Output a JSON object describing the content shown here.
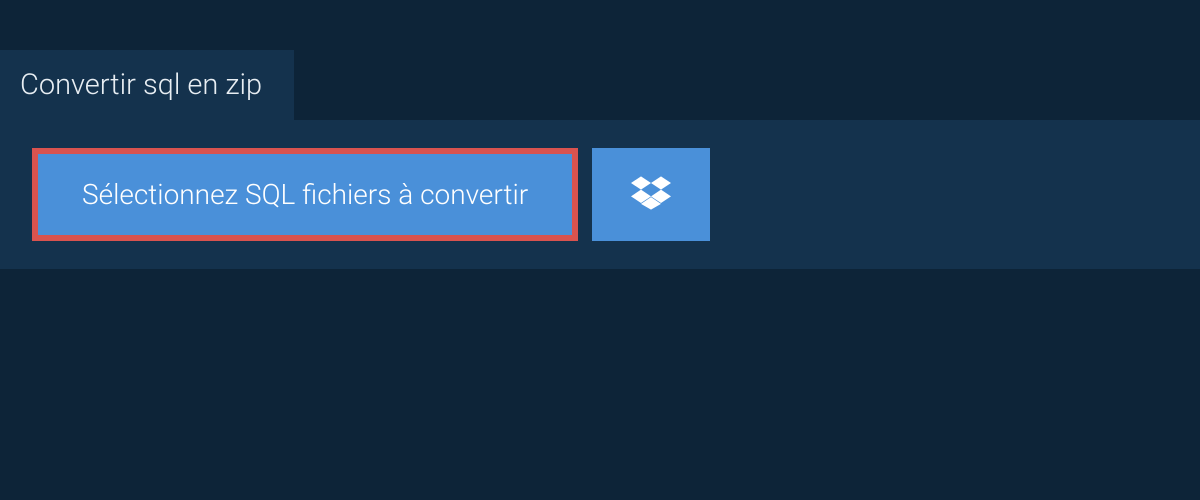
{
  "tab": {
    "title": "Convertir sql en zip"
  },
  "actions": {
    "select_files_label": "Sélectionnez SQL fichiers à convertir"
  },
  "colors": {
    "background": "#0d2438",
    "panel": "#14324d",
    "button": "#4a90d9",
    "highlight_border": "#d9534f"
  }
}
